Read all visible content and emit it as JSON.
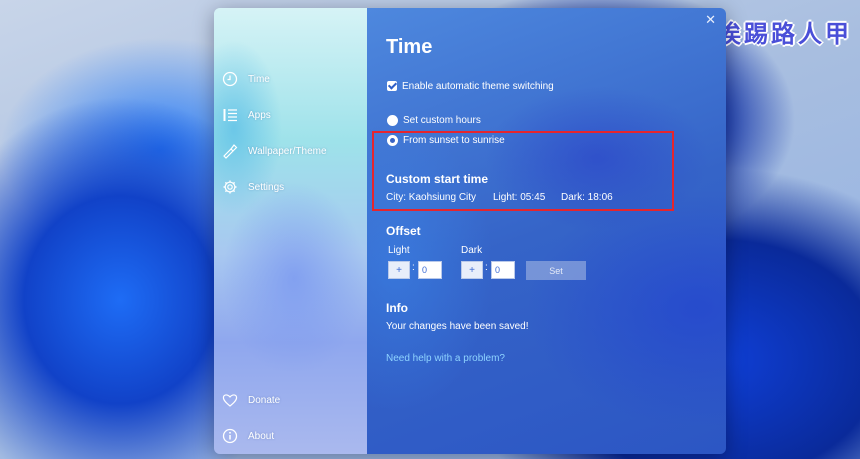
{
  "watermark": "挨踢路人甲",
  "sidebar": {
    "items": [
      {
        "label": "Time",
        "icon": "clock-icon"
      },
      {
        "label": "Apps",
        "icon": "list-icon"
      },
      {
        "label": "Wallpaper/Theme",
        "icon": "paint-icon"
      },
      {
        "label": "Settings",
        "icon": "gear-icon"
      },
      {
        "label": "Donate",
        "icon": "heart-icon"
      },
      {
        "label": "About",
        "icon": "info-icon"
      }
    ]
  },
  "window": {
    "close": "✕"
  },
  "main": {
    "title": "Time",
    "auto_switch_label": "Enable automatic theme switching",
    "auto_switch_checked": true,
    "radio_custom_hours": "Set custom hours",
    "radio_sunset": "From sunset to sunrise",
    "custom_start": {
      "heading": "Custom start time",
      "city": "City: Kaohsiung City",
      "light": "Light: 05:45",
      "dark": "Dark: 18:06"
    },
    "offset": {
      "heading": "Offset",
      "light_label": "Light",
      "dark_label": "Dark",
      "plus": "+",
      "colon": ":",
      "light_value": "0",
      "dark_value": "0",
      "set_label": "Set"
    },
    "info": {
      "heading": "Info",
      "message": "Your changes have been saved!",
      "help_link": "Need help with a problem?"
    }
  },
  "colors": {
    "highlight_border": "#e6252d",
    "link": "#8ed3ff",
    "watermark": "#4a4fd8"
  }
}
